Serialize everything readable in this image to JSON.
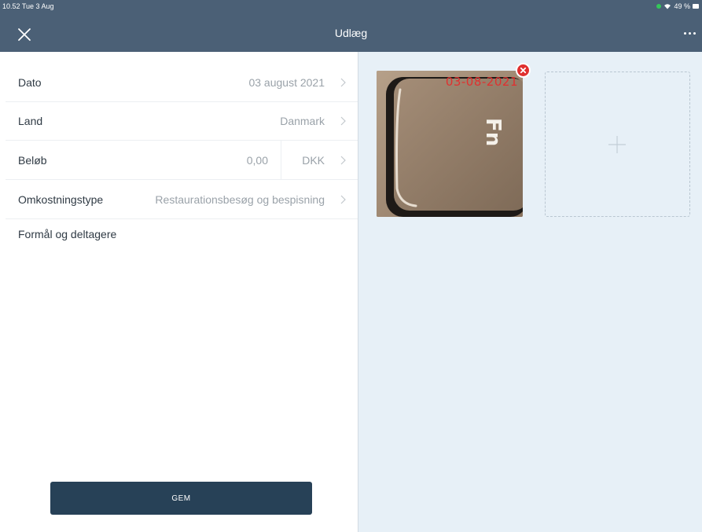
{
  "status_bar": {
    "time": "10.52  Tue 3 Aug",
    "battery": "49 %"
  },
  "nav": {
    "title": "Udlæg",
    "close_icon": "close-icon",
    "more_icon": "more-icon"
  },
  "form": {
    "date": {
      "label": "Dato",
      "value": "03 august 2021"
    },
    "country": {
      "label": "Land",
      "value": "Danmark"
    },
    "amount": {
      "label": "Beløb",
      "value": "0,00",
      "currency": "DKK"
    },
    "expense_type": {
      "label": "Omkostningstype",
      "value": "Restaurationsbesøg og bespisning"
    },
    "purpose": {
      "label": "Formål og deltagere"
    },
    "save_label": "GEM"
  },
  "receipt": {
    "date_stamp": "03-08-2021",
    "key_text": "Fn"
  },
  "colors": {
    "nav_bg": "#4b6076",
    "save_bg": "#274157",
    "right_panel_bg": "#e7f0f7",
    "remove_red": "#e0302f"
  }
}
